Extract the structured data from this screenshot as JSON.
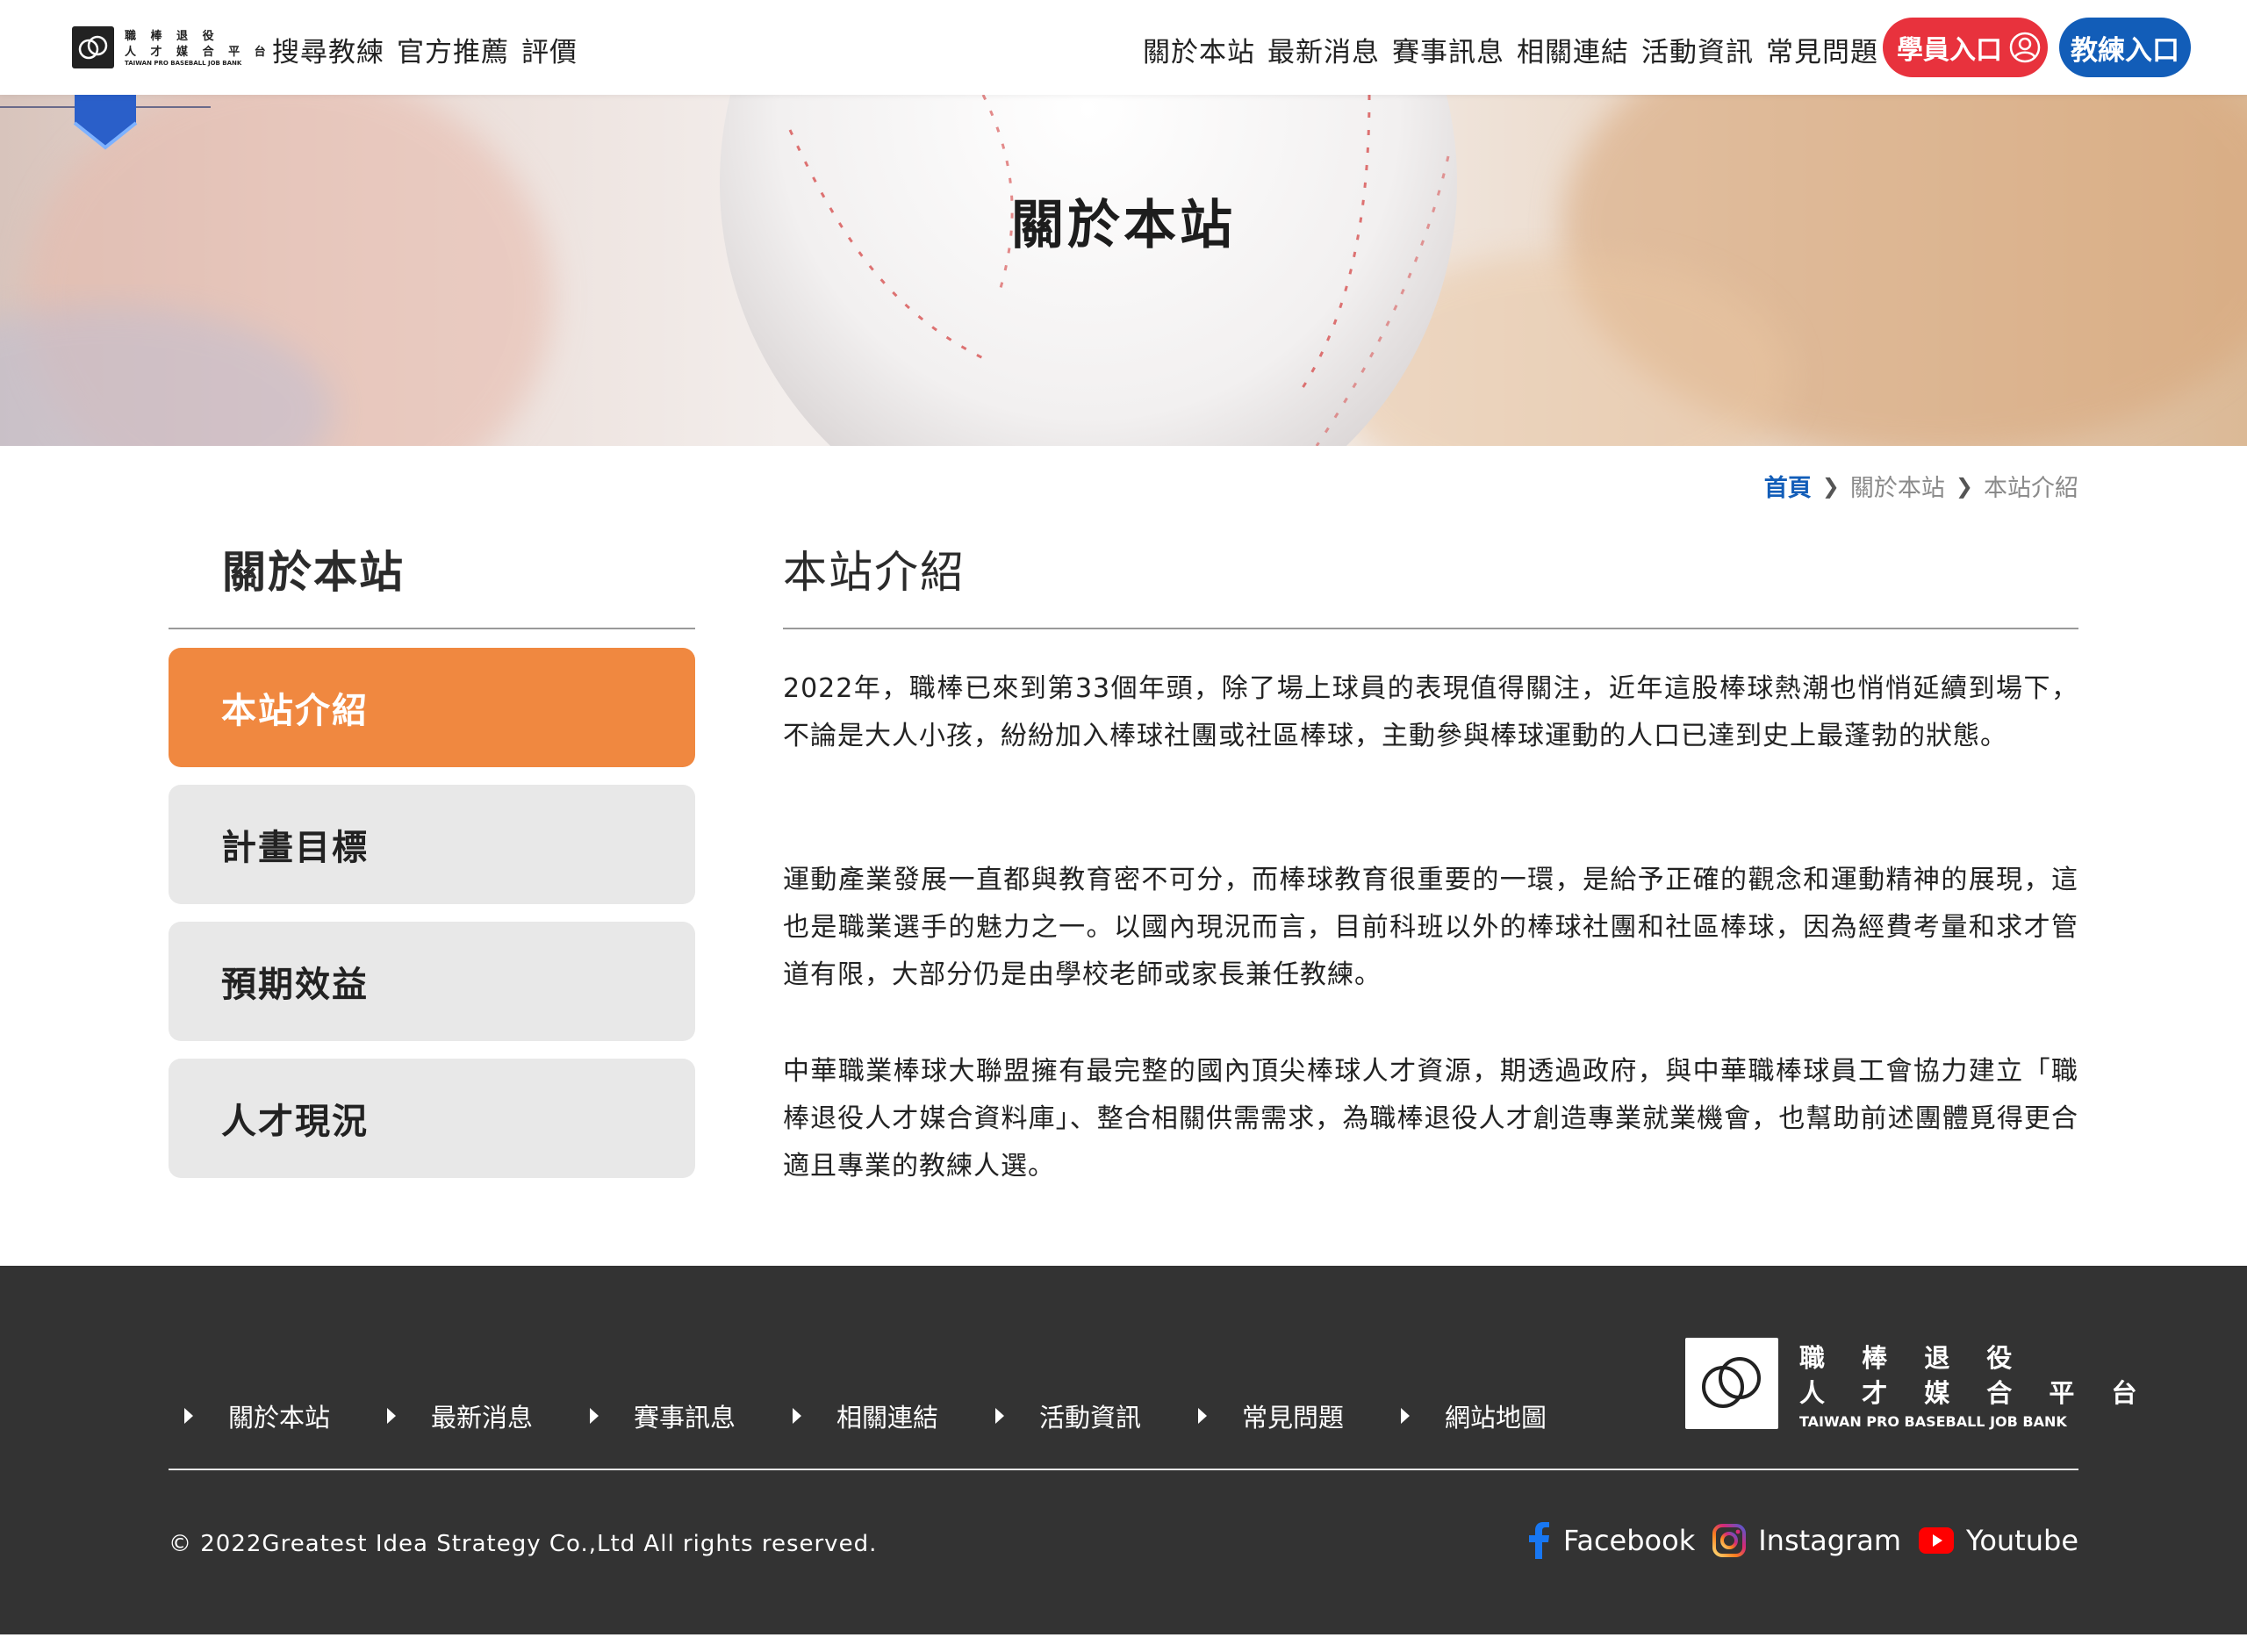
{
  "header": {
    "logo": {
      "line1": "職 棒 退 役",
      "line2": "人 才 媒 合 平 台",
      "en": "TAIWAN PRO BASEBALL JOB BANK"
    },
    "nav_left": [
      "搜尋教練",
      "官方推薦",
      "評價"
    ],
    "nav_right": [
      "關於本站",
      "最新消息",
      "賽事訊息",
      "相關連結",
      "活動資訊",
      "常見問題"
    ],
    "student_button": "學員入口",
    "coach_button": "教練入口"
  },
  "hero": {
    "title": "關於本站"
  },
  "breadcrumb": {
    "home": "首頁",
    "level1": "關於本站",
    "current": "本站介紹"
  },
  "sidebar": {
    "title": "關於本站",
    "items": [
      {
        "label": "本站介紹",
        "active": true
      },
      {
        "label": "計畫目標",
        "active": false
      },
      {
        "label": "預期效益",
        "active": false
      },
      {
        "label": "人才現況",
        "active": false
      }
    ]
  },
  "content": {
    "title": "本站介紹",
    "paragraphs": [
      "2022年，職棒已來到第33個年頭，除了場上球員的表現值得關注，近年這股棒球熱潮也悄悄延續到場下，不論是大人小孩，紛紛加入棒球社團或社區棒球，主動參與棒球運動的人口已達到史上最蓬勃的狀態。",
      "運動產業發展一直都與教育密不可分，而棒球教育很重要的一環，是給予正確的觀念和運動精神的展現，這也是職業選手的魅力之一。以國內現況而言，目前科班以外的棒球社團和社區棒球，因為經費考量和求才管道有限，大部分仍是由學校老師或家長兼任教練。",
      "中華職業棒球大聯盟擁有最完整的國內頂尖棒球人才資源，期透過政府，與中華職棒球員工會協力建立「職棒退役人才媒合資料庫」、整合相關供需需求，為職棒退役人才創造專業就業機會，也幫助前述團體覓得更合適且專業的教練人選。"
    ]
  },
  "footer": {
    "links": [
      "關於本站",
      "最新消息",
      "賽事訊息",
      "相關連結",
      "活動資訊",
      "常見問題",
      "網站地圖"
    ],
    "logo": {
      "line1": "職 棒 退 役",
      "line2": "人 才 媒 合 平 台",
      "en": "TAIWAN PRO BASEBALL JOB BANK"
    },
    "copyright": "© 2022Greatest Idea Strategy Co.,Ltd All rights reserved.",
    "social": [
      {
        "label": "Facebook",
        "icon": "facebook-icon"
      },
      {
        "label": "Instagram",
        "icon": "instagram-icon"
      },
      {
        "label": "Youtube",
        "icon": "youtube-icon"
      }
    ]
  },
  "colors": {
    "accent_orange": "#f08840",
    "student_red": "#e8323d",
    "coach_blue": "#125db8",
    "footer_bg": "#333333"
  }
}
